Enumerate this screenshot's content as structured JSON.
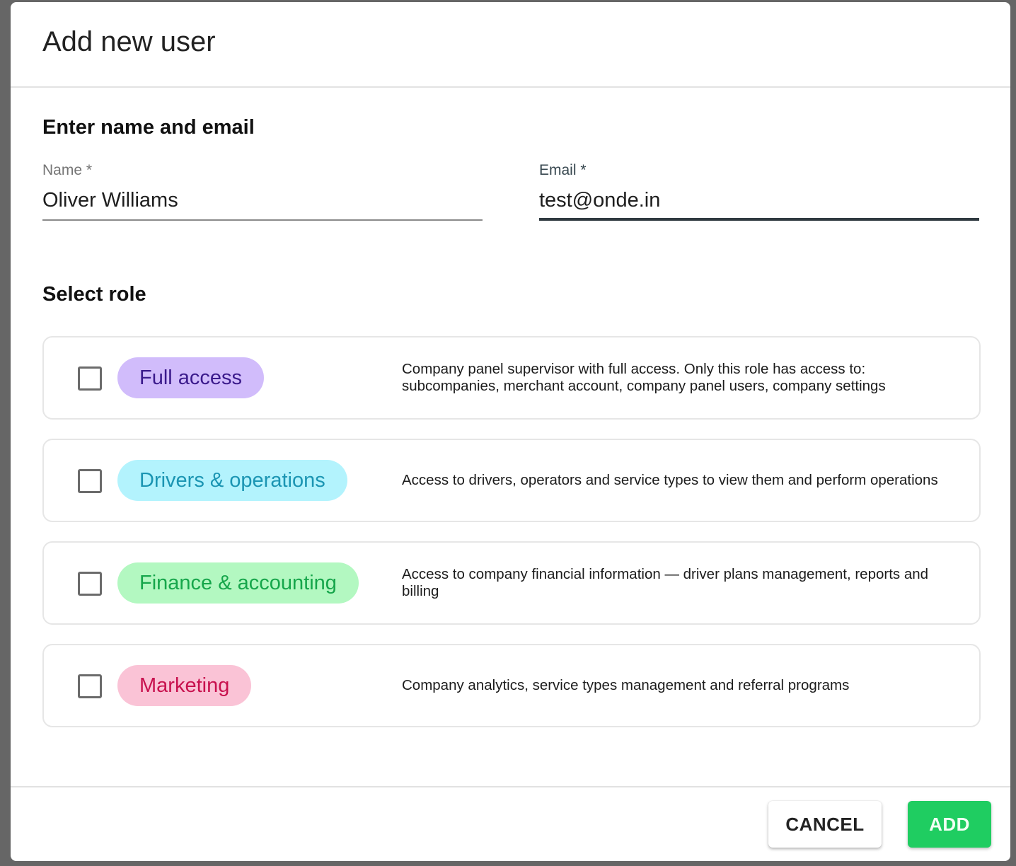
{
  "dialog": {
    "title": "Add new user"
  },
  "identity_section": {
    "title": "Enter name and email",
    "name_field": {
      "label": "Name *",
      "value": "Oliver Williams"
    },
    "email_field": {
      "label": "Email *",
      "value": "test@onde.in",
      "focused": true
    }
  },
  "role_section": {
    "title": "Select role",
    "roles": [
      {
        "label": "Full access",
        "checked": false,
        "chip_bg": "#d1bcfb",
        "chip_fg": "#3b1a8c",
        "description": "Company panel supervisor with full access. Only this role has access to: subcompanies, merchant account, company panel users, company settings"
      },
      {
        "label": "Drivers & operations",
        "checked": false,
        "chip_bg": "#b3f3fd",
        "chip_fg": "#1b95b3",
        "description": "Access to drivers, operators and service types to view them and perform operations"
      },
      {
        "label": "Finance & accounting",
        "checked": false,
        "chip_bg": "#b3f8c1",
        "chip_fg": "#16a64b",
        "description": "Access to company financial information — driver plans management, reports and billing"
      },
      {
        "label": "Marketing",
        "checked": false,
        "chip_bg": "#fac3d6",
        "chip_fg": "#c8114e",
        "description": "Company analytics, service types management and referral programs"
      }
    ]
  },
  "footer": {
    "cancel_label": "CANCEL",
    "add_label": "ADD",
    "add_color": "#1fcd61"
  }
}
